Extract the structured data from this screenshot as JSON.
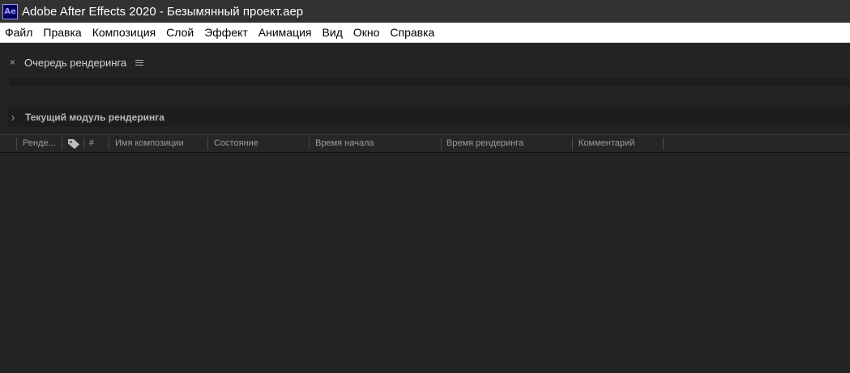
{
  "window": {
    "app_icon": "Ae",
    "title": "Adobe After Effects 2020 - Безымянный проект.aep"
  },
  "menu": [
    "Файл",
    "Правка",
    "Композиция",
    "Слой",
    "Эффект",
    "Анимация",
    "Вид",
    "Окно",
    "Справка"
  ],
  "panel": {
    "close_glyph": "×",
    "tab_label": "Очередь рендеринга",
    "module_label": "Текущий модуль рендеринга",
    "columns": {
      "render": "Рендe...",
      "number": "#",
      "comp_name": "Имя композиции",
      "status": "Состояние",
      "start_time": "Время начала",
      "render_time": "Время рендеринга",
      "comment": "Комментарий"
    }
  },
  "icons": {
    "tag": "tag-icon",
    "close": "close-icon",
    "panel_menu": "panel-menu-icon",
    "chevron": "chevron-right-icon"
  },
  "colors": {
    "accent_icon_bg": "#00005b",
    "accent_icon_fg": "#9999ff",
    "panel_bg": "#232323"
  }
}
